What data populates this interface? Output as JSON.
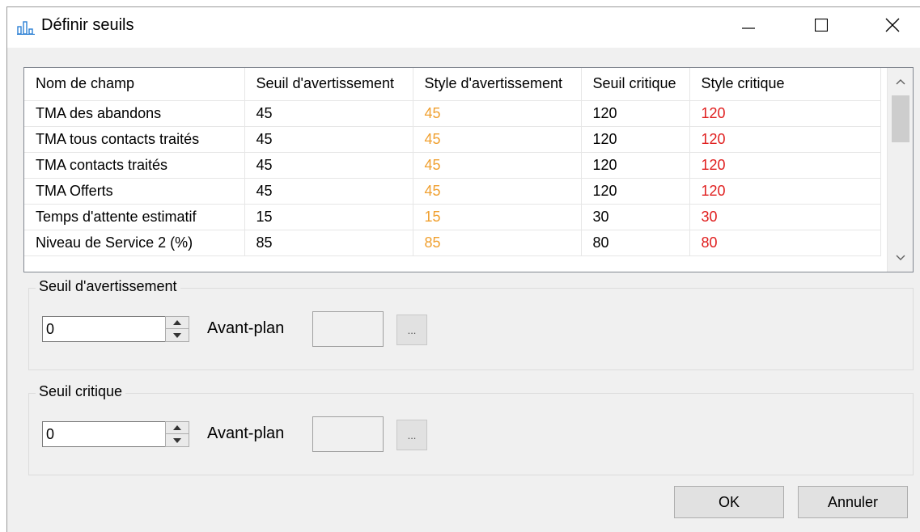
{
  "window": {
    "title": "Définir seuils",
    "icon": "bar-chart-icon"
  },
  "grid": {
    "columns": [
      "Nom de champ",
      "Seuil d'avertissement",
      "Style d'avertissement",
      "Seuil critique",
      "Style critique"
    ],
    "rows": [
      {
        "name": "TMA des abandons",
        "warn": "45",
        "warn_style": "45",
        "crit": "120",
        "crit_style": "120"
      },
      {
        "name": "TMA tous contacts traités",
        "warn": "45",
        "warn_style": "45",
        "crit": "120",
        "crit_style": "120"
      },
      {
        "name": "TMA contacts traités",
        "warn": "45",
        "warn_style": "45",
        "crit": "120",
        "crit_style": "120"
      },
      {
        "name": "TMA Offerts",
        "warn": "45",
        "warn_style": "45",
        "crit": "120",
        "crit_style": "120"
      },
      {
        "name": "Temps d'attente estimatif",
        "warn": "15",
        "warn_style": "15",
        "crit": "30",
        "crit_style": "30"
      },
      {
        "name": "Niveau de Service 2 (%)",
        "warn": "85",
        "warn_style": "85",
        "crit": "80",
        "crit_style": "80"
      }
    ],
    "warn_style_color": "#f0a030",
    "crit_style_color": "#e02020"
  },
  "warning_group": {
    "label": "Seuil d'avertissement",
    "value": "0",
    "foreground_label": "Avant-plan",
    "browse_label": "..."
  },
  "critical_group": {
    "label": "Seuil critique",
    "value": "0",
    "foreground_label": "Avant-plan",
    "browse_label": "..."
  },
  "buttons": {
    "ok": "OK",
    "cancel": "Annuler"
  }
}
